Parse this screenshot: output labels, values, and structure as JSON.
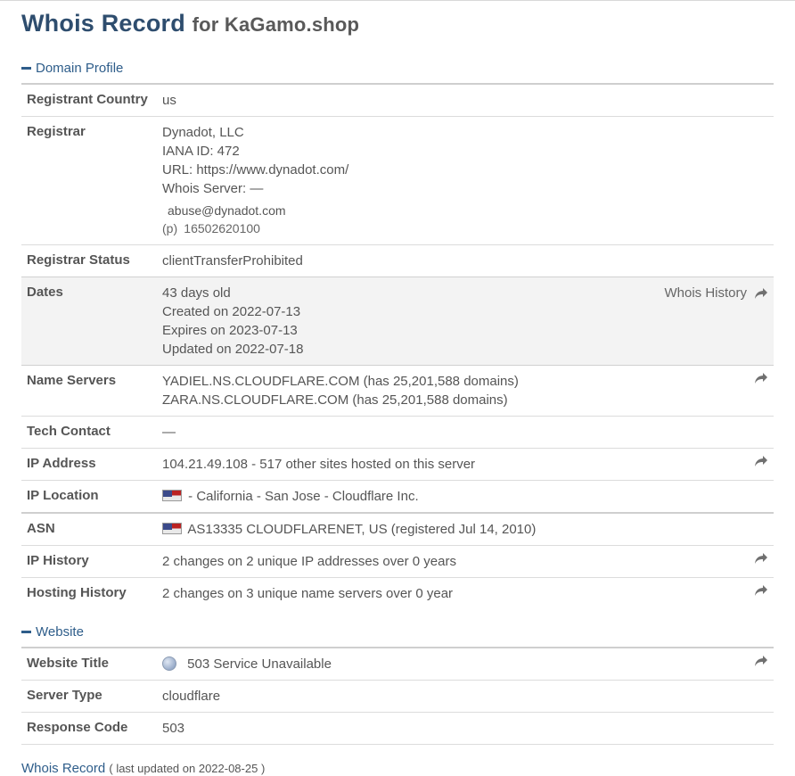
{
  "header": {
    "title": "Whois Record",
    "for_text": "for KaGamo.shop"
  },
  "domain_profile": {
    "section_title": "Domain Profile",
    "registrant_country": {
      "label": "Registrant Country",
      "value": "us"
    },
    "registrar": {
      "label": "Registrar",
      "name": "Dynadot, LLC",
      "iana": "IANA ID: 472",
      "url": "URL: https://www.dynadot.com/",
      "whois_server": "Whois Server: —",
      "email": "abuse@dynadot.com",
      "phone_prefix": "(p)",
      "phone": "16502620100"
    },
    "registrar_status": {
      "label": "Registrar Status",
      "value": "clientTransferProhibited"
    },
    "dates": {
      "label": "Dates",
      "age": "43 days old",
      "created": "Created on 2022-07-13",
      "expires": "Expires on 2023-07-13",
      "updated": "Updated on 2022-07-18",
      "history_link": "Whois History"
    },
    "name_servers": {
      "label": "Name Servers",
      "ns1": "YADIEL.NS.CLOUDFLARE.COM (has 25,201,588 domains)",
      "ns2": "ZARA.NS.CLOUDFLARE.COM (has 25,201,588 domains)"
    },
    "tech_contact": {
      "label": "Tech Contact",
      "value": "—"
    },
    "ip_address": {
      "label": "IP Address",
      "value": "104.21.49.108 - 517 other sites hosted on this server"
    },
    "ip_location": {
      "label": "IP Location",
      "value": "- California - San Jose - Cloudflare Inc."
    },
    "asn": {
      "label": "ASN",
      "value": "AS13335 CLOUDFLARENET, US (registered Jul 14, 2010)"
    },
    "ip_history": {
      "label": "IP History",
      "value": "2 changes on 2 unique IP addresses over 0 years"
    },
    "hosting_history": {
      "label": "Hosting History",
      "value": "2 changes on 3 unique name servers over 0 year"
    }
  },
  "website": {
    "section_title": "Website",
    "website_title": {
      "label": "Website Title",
      "value": "503 Service Unavailable"
    },
    "server_type": {
      "label": "Server Type",
      "value": "cloudflare"
    },
    "response_code": {
      "label": "Response Code",
      "value": "503"
    }
  },
  "footer": {
    "title": "Whois Record",
    "updated": "( last updated on 2022-08-25 )"
  },
  "colors": {
    "accent": "#2e5d8a",
    "title": "#2e4d6e",
    "arrow": "#707070"
  },
  "icons": {
    "arrow": "share-arrow-icon",
    "flag": "us-flag-icon",
    "globe": "globe-icon",
    "collapse": "minus-icon"
  }
}
